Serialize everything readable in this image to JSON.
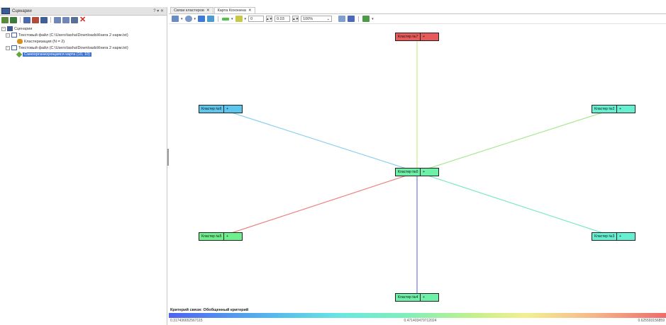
{
  "left_panel": {
    "title": "Сценарии",
    "controls": "? ▾ ✕",
    "tree": [
      {
        "label": "Сценарии",
        "icon": "scenario-root-icon",
        "level": 0,
        "expander": "−"
      },
      {
        "label": "Текстовый файл (C:\\Users\\tasha\\Downloads\\Книга 2 нарм.txt)",
        "icon": "text-file-icon",
        "level": 1,
        "expander": "−"
      },
      {
        "label": "Кластеризация (N = 2)",
        "icon": "clustering-icon",
        "level": 2,
        "expander": ""
      },
      {
        "label": "Текстовый файл (C:\\Users\\tasha\\Downloads\\Книга 2 нарм.txt)",
        "icon": "text-file-icon",
        "level": 1,
        "expander": "−"
      },
      {
        "label": "Самоорганизующаяся карта (10, 10)",
        "icon": "som-map-icon",
        "level": 2,
        "expander": "",
        "selected": true
      }
    ]
  },
  "tabs": [
    {
      "label": "Связи кластеров",
      "close": "✕",
      "active": false
    },
    {
      "label": "Карта Кохонена",
      "close": "✕",
      "active": true
    }
  ],
  "map_toolbar": {
    "value1": "0",
    "value2": "0.03",
    "zoom": "100%",
    "zoom_arrow": "⌄"
  },
  "map": {
    "nodes": [
      {
        "id": "n7",
        "label": "Кластер №7",
        "ctrl": "+",
        "color": "#e85a5a"
      },
      {
        "id": "n6",
        "label": "Кластер №6",
        "ctrl": "+",
        "color": "#5cc6ee"
      },
      {
        "id": "n2",
        "label": "Кластер №2",
        "ctrl": "+",
        "color": "#66f0d2"
      },
      {
        "id": "n0",
        "label": "Кластер №0",
        "ctrl": "+",
        "color": "#6ef0a8"
      },
      {
        "id": "n5",
        "label": "Кластер №5",
        "ctrl": "+",
        "color": "#6ef08c"
      },
      {
        "id": "n3",
        "label": "Кластер №3",
        "ctrl": "+",
        "color": "#66f0d2"
      },
      {
        "id": "n4",
        "label": "Кластер №4",
        "ctrl": "+",
        "color": "#6ef0a8"
      }
    ],
    "edges": [
      {
        "to": "n7",
        "color": "#c8ec8a"
      },
      {
        "to": "n6",
        "color": "#8ed0ee"
      },
      {
        "to": "n2",
        "color": "#a8e890"
      },
      {
        "to": "n5",
        "color": "#ee8080"
      },
      {
        "to": "n3",
        "color": "#7ee8cc"
      },
      {
        "to": "n4",
        "color": "#6a7ce6"
      }
    ]
  },
  "legend": {
    "title": "Критерий связи: Обобщенный критерий",
    "min": "0.317436652567115",
    "mid": "0.471403479712024",
    "max": "0.625593156859"
  }
}
